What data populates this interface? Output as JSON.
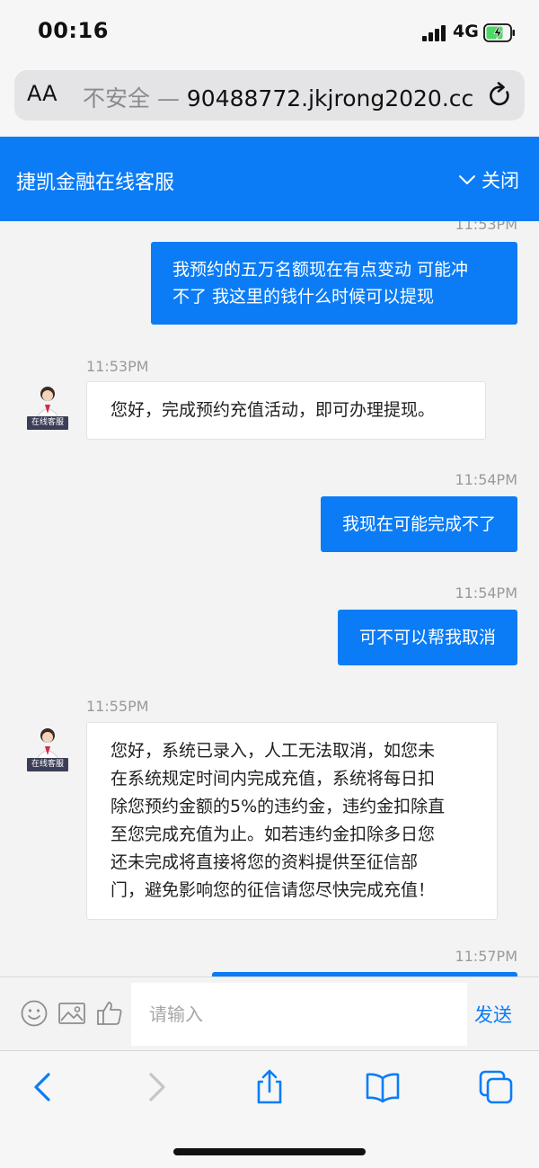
{
  "status": {
    "time": "00:16",
    "network": "4G",
    "battery_charging": true
  },
  "browser": {
    "text_size_label": "AA",
    "security_label": "不安全 —",
    "url": "90488772.jkjrong2020.cc"
  },
  "chat": {
    "title": "捷凯金融在线客服",
    "close_label": "关闭",
    "agent_badge": "在线客服",
    "messages": [
      {
        "direction": "out",
        "time": "11:53PM",
        "text_line1": "我预约的五万名额现在有点变动 可能冲",
        "text_line2": "不了 我这里的钱什么时候可以提现"
      },
      {
        "direction": "in",
        "time": "11:53PM",
        "text": "您好，完成预约充值活动，即可办理提现。"
      },
      {
        "direction": "out",
        "time": "11:54PM",
        "text": "我现在可能完成不了"
      },
      {
        "direction": "out",
        "time": "11:54PM",
        "text": "可不可以帮我取消"
      },
      {
        "direction": "in",
        "time": "11:55PM",
        "lines": [
          "您好，系统已录入，人工无法取消，如您未",
          "在系统规定时间内完成充值，系统将每日扣",
          "除您预约金额的5%的违约金，违约金扣除直",
          "至您完成充值为止。如若违约金扣除多日您",
          "还未完成将直接将您的资料提供至征信部",
          "门，避免影响您的征信请您尽快完成充值！"
        ]
      },
      {
        "direction": "out",
        "time": "11:57PM"
      }
    ]
  },
  "input": {
    "placeholder": "请输入",
    "send_label": "发送"
  },
  "colors": {
    "accent": "#0b7cf6",
    "chat_background": "#f3f3f3",
    "timestamp": "#9a9a9a"
  },
  "icons": [
    "smiley-icon",
    "image-icon",
    "thumbs-up-icon",
    "back-icon",
    "forward-icon",
    "share-icon",
    "bookmarks-icon",
    "tabs-icon",
    "reload-icon"
  ]
}
